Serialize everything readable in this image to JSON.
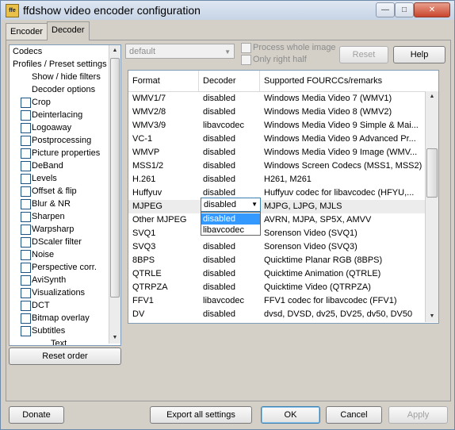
{
  "window": {
    "title": "ffdshow video encoder configuration",
    "icon_text": "ffe",
    "icon": "app-icon",
    "controls": [
      "minimize-icon",
      "maximize-icon",
      "close-icon"
    ]
  },
  "tabs": [
    "Encoder",
    "Decoder"
  ],
  "active_tab": "Decoder",
  "sidebar": {
    "header_items": [
      "Codecs",
      "Profiles / Preset settings"
    ],
    "sub_items": [
      "Show / hide filters",
      "Decoder options"
    ],
    "filters": [
      "Crop",
      "Deinterlacing",
      "Logoaway",
      "Postprocessing",
      "Picture properties",
      "DeBand",
      "Levels",
      "Offset & flip",
      "Blur & NR",
      "Sharpen",
      "Warpsharp",
      "DScaler filter",
      "Noise",
      "Perspective corr.",
      "AviSynth",
      "Visualizations",
      "DCT",
      "Bitmap overlay",
      "Subtitles"
    ],
    "partial_item": "Text",
    "reset_order_label": "Reset order"
  },
  "preset": {
    "value": "default",
    "process_whole_image": "Process whole image",
    "only_right_half": "Only right half",
    "reset_label": "Reset",
    "help_label": "Help"
  },
  "codec_table": {
    "headers": [
      "Format",
      "Decoder",
      "Supported FOURCCs/remarks"
    ],
    "rows": [
      [
        "WMV1/7",
        "disabled",
        "Windows Media Video 7 (WMV1)"
      ],
      [
        "WMV2/8",
        "disabled",
        "Windows Media Video 8 (WMV2)"
      ],
      [
        "WMV3/9",
        "libavcodec",
        "Windows Media Video 9 Simple & Mai..."
      ],
      [
        "VC-1",
        "disabled",
        "Windows Media Video 9 Advanced Pr..."
      ],
      [
        "WMVP",
        "disabled",
        "Windows Media Video 9 Image (WMV..."
      ],
      [
        "MSS1/2",
        "disabled",
        "Windows Screen Codecs (MSS1, MSS2)"
      ],
      [
        "H.261",
        "disabled",
        "H261, M261"
      ],
      [
        "Huffyuv",
        "disabled",
        "Huffyuv codec for libavcodec (HFYU,..."
      ],
      [
        "MJPEG",
        "disabled",
        "MJPG, LJPG, MJLS"
      ],
      [
        "Other MJPEG",
        "",
        "AVRN, MJPA, SP5X, AMVV"
      ],
      [
        "SVQ1",
        "",
        "Sorenson Video (SVQ1)"
      ],
      [
        "SVQ3",
        "disabled",
        "Sorenson Video (SVQ3)"
      ],
      [
        "8BPS",
        "disabled",
        "Quicktime Planar RGB (8BPS)"
      ],
      [
        "QTRLE",
        "disabled",
        "Quicktime Animation (QTRLE)"
      ],
      [
        "QTRPZA",
        "disabled",
        "Quicktime Video (QTRPZA)"
      ],
      [
        "FFV1",
        "libavcodec",
        "FFV1 codec for libavcodec (FFV1)"
      ],
      [
        "DV",
        "disabled",
        "dvsd, DVSD, dv25, DV25, dv50, DV50"
      ]
    ],
    "selected_row": 8,
    "dropdown": {
      "value": "disabled",
      "options": [
        "disabled",
        "libavcodec"
      ],
      "highlighted": "disabled"
    }
  },
  "footer": {
    "donate": "Donate",
    "export": "Export all settings",
    "ok": "OK",
    "cancel": "Cancel",
    "apply": "Apply"
  }
}
